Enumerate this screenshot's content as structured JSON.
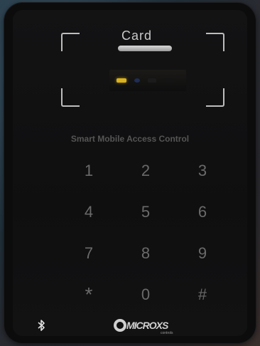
{
  "reader": {
    "card_label": "Card",
    "title": "Smart Mobile Access Control"
  },
  "keypad": {
    "keys": [
      "1",
      "2",
      "3",
      "4",
      "5",
      "6",
      "7",
      "8",
      "9",
      "*",
      "0",
      "#"
    ]
  },
  "brand": {
    "name": "MICROXS",
    "sub": "controls"
  },
  "icons": {
    "bluetooth": "bluetooth-icon",
    "brand_logo": "brand-logo-icon"
  },
  "colors": {
    "status_led": "#d9b21e",
    "key_text": "#6a6a6a"
  }
}
